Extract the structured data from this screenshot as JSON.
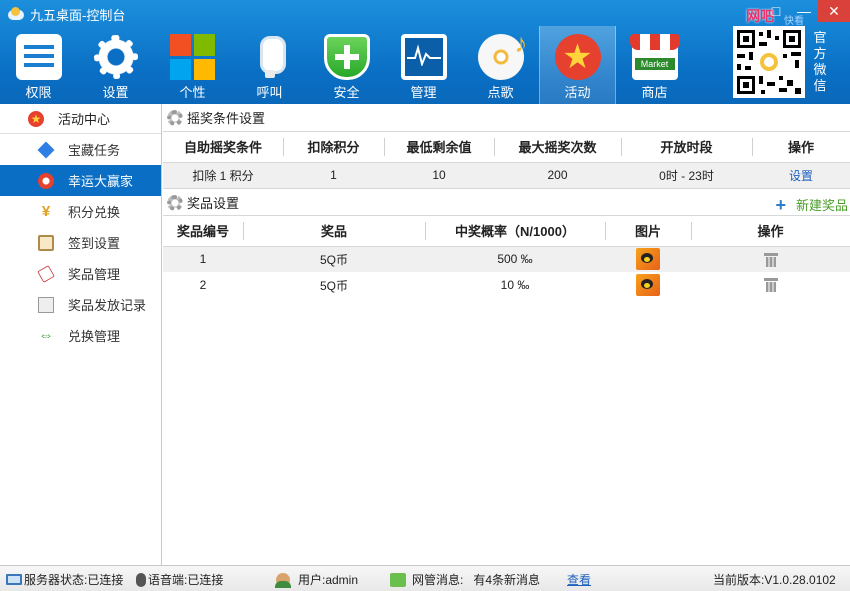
{
  "window": {
    "title": "九五桌面-控制台",
    "controls": [
      "□",
      "—",
      "✕"
    ]
  },
  "brand": {
    "name": "网吧",
    "sub": "快看",
    "official_wechat": "官方微信"
  },
  "toolbar": [
    {
      "label": "权限",
      "icon": "permission-icon"
    },
    {
      "label": "设置",
      "icon": "gear-icon"
    },
    {
      "label": "个性",
      "icon": "windows-tiles-icon"
    },
    {
      "label": "呼叫",
      "icon": "microphone-icon"
    },
    {
      "label": "安全",
      "icon": "shield-icon"
    },
    {
      "label": "管理",
      "icon": "monitor-icon"
    },
    {
      "label": "点歌",
      "icon": "music-disc-icon"
    },
    {
      "label": "活动",
      "icon": "star-badge-icon",
      "active": true
    },
    {
      "label": "商店",
      "icon": "market-icon"
    }
  ],
  "sidebar": {
    "header": "活动中心",
    "items": [
      {
        "label": "宝藏任务",
        "icon": "diamond-icon"
      },
      {
        "label": "幸运大赢家",
        "icon": "lucky-wheel-icon",
        "active": true
      },
      {
        "label": "积分兑换",
        "icon": "points-icon"
      },
      {
        "label": "签到设置",
        "icon": "clipboard-icon"
      },
      {
        "label": "奖品管理",
        "icon": "tag-icon"
      },
      {
        "label": "奖品发放记录",
        "icon": "document-icon"
      },
      {
        "label": "兑换管理",
        "icon": "exchange-icon"
      }
    ]
  },
  "draw_conditions": {
    "title": "摇奖条件设置",
    "columns": [
      "自助摇奖条件",
      "扣除积分",
      "最低剩余值",
      "最大摇奖次数",
      "开放时段",
      "操作"
    ],
    "rows": [
      {
        "condition": "扣除 1 积分",
        "deduct": "1",
        "min_remaining": "10",
        "max_draws": "200",
        "hours": "0时 - 23时",
        "action": "设置"
      }
    ]
  },
  "prizes": {
    "title": "奖品设置",
    "new_button": "新建奖品",
    "columns": [
      "奖品编号",
      "奖品",
      "中奖概率（N/1000）",
      "图片",
      "操作"
    ],
    "rows": [
      {
        "id": "1",
        "name": "5Q币",
        "probability": "500 ‰"
      },
      {
        "id": "2",
        "name": "5Q币",
        "probability": "10 ‰"
      }
    ]
  },
  "status": {
    "server": "服务器状态:已连接",
    "voice": "语音端:已连接",
    "user": "用户:admin",
    "msg_label": "网管消息:",
    "msg_value": "有4条新消息",
    "view_link": "查看",
    "version": "当前版本:V1.0.28.0102"
  }
}
